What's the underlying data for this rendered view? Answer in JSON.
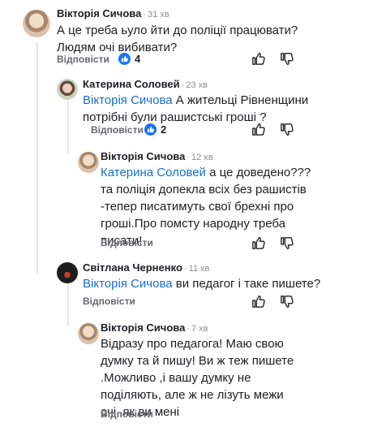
{
  "comments": [
    {
      "author": "Вікторія Сичова",
      "time": "31 хв",
      "text_lines": [
        "А це треба ьуло йти до поліції працювати?",
        "Людям очі вибивати?"
      ],
      "reply_label": "Відповісти",
      "likes": "4"
    },
    {
      "author": "Катерина Соловей",
      "time": "23 хв",
      "mention": "Вікторія Сичова",
      "text_lines": [
        " А жительці Рівненщини",
        "потрібні були рашистські гроші ?"
      ],
      "reply_label": "Відповісти",
      "likes": "2"
    },
    {
      "author": "Вікторія Сичова",
      "time": "12 хв",
      "mention": "Катерина Соловей",
      "text_lines": [
        " а це доведено???",
        "та поліція допекла всіх без рашистів",
        "-тепер писатимуть свої брехні про",
        "гроші.Про помсту народну треба",
        "писати!"
      ],
      "reply_label": "Відповісти"
    },
    {
      "author": "Світлана Черненко",
      "time": "11 хв",
      "mention": "Вікторія Сичова",
      "text_lines": [
        " ви педагог і таке пишете?"
      ],
      "reply_label": "Відповісти"
    },
    {
      "author": "Вікторія Сичова",
      "time": "7 хв",
      "text_lines": [
        "Відразу про педагога! Маю свою",
        "думку та й пишу! Ви ж теж пишете",
        ".Можливо ,і вашу думку не",
        "поділяють, але ж не лізуть межи",
        "очі ,як ви мені"
      ],
      "reply_label": "Відповісти"
    }
  ],
  "separator": "·",
  "icons": {
    "upvote": "thumb-up-icon",
    "downvote": "thumb-down-icon",
    "like": "like-badge-icon"
  },
  "colors": {
    "mention": "#1a6dcf",
    "like_badge": "#1877f2",
    "muted": "#65676b"
  }
}
